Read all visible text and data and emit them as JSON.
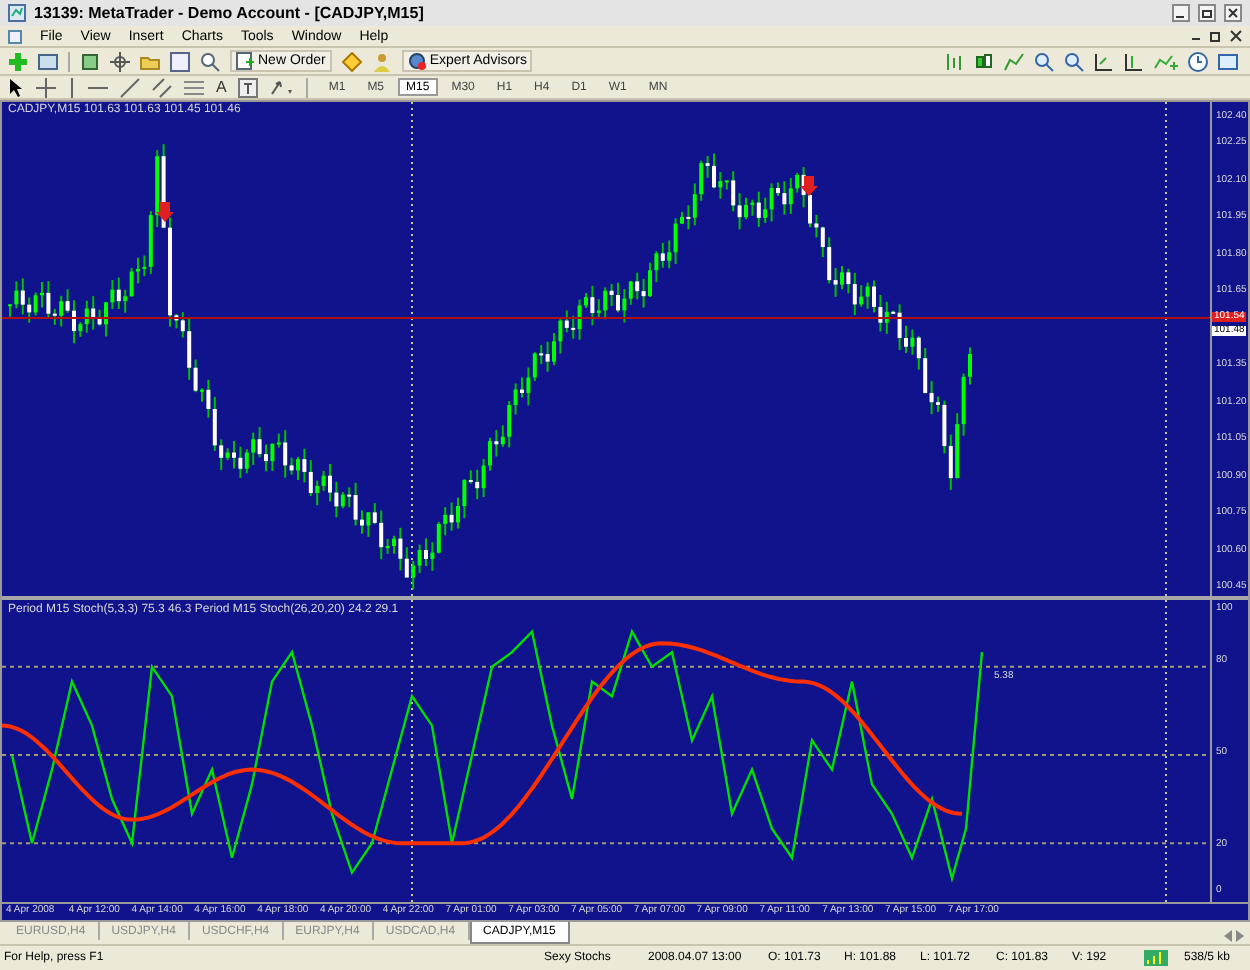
{
  "window": {
    "title": "13139: MetaTrader - Demo Account - [CADJPY,M15]"
  },
  "menu": [
    "File",
    "View",
    "Insert",
    "Charts",
    "Tools",
    "Window",
    "Help"
  ],
  "toolbar": {
    "buttons": [
      "New Order",
      "Expert Advisors"
    ]
  },
  "drawing_tools": {
    "text_tool": "A"
  },
  "timeframes": [
    {
      "label": "M1",
      "selected": false
    },
    {
      "label": "M5",
      "selected": false
    },
    {
      "label": "M15",
      "selected": true
    },
    {
      "label": "M30",
      "selected": false
    },
    {
      "label": "H1",
      "selected": false
    },
    {
      "label": "H4",
      "selected": false
    },
    {
      "label": "D1",
      "selected": false
    },
    {
      "label": "W1",
      "selected": false
    },
    {
      "label": "MN",
      "selected": false
    }
  ],
  "chart": {
    "header": "CADJPY,M15  101.63 101.63 101.45 101.46",
    "price_axis": [
      "102.40",
      "102.25",
      "102.10",
      "101.95",
      "101.80",
      "101.65",
      "101.35",
      "101.20",
      "101.05",
      "100.90",
      "100.75",
      "100.60",
      "100.45"
    ],
    "bid_label": "101.54",
    "ask_label": "101.48"
  },
  "indicator": {
    "header": "Period M15 Stoch(5,3,3) 75.3 46.3  Period M15 Stoch(26,20,20) 24.2 29.1",
    "value_label": "5.38",
    "axis": [
      "100",
      "80",
      "50",
      "20",
      "0"
    ]
  },
  "time_axis": [
    "4 Apr 2008",
    "4 Apr 12:00",
    "4 Apr 14:00",
    "4 Apr 16:00",
    "4 Apr 18:00",
    "4 Apr 20:00",
    "4 Apr 22:00",
    "7 Apr 01:00",
    "7 Apr 03:00",
    "7 Apr 05:00",
    "7 Apr 07:00",
    "7 Apr 09:00",
    "7 Apr 11:00",
    "7 Apr 13:00",
    "7 Apr 15:00",
    "7 Apr 17:00"
  ],
  "tabs": [
    {
      "label": "EURUSD,H4",
      "selected": false
    },
    {
      "label": "USDJPY,H4",
      "selected": false
    },
    {
      "label": "USDCHF,H4",
      "selected": false
    },
    {
      "label": "EURJPY,H4",
      "selected": false
    },
    {
      "label": "USDCAD,H4",
      "selected": false
    },
    {
      "label": "CADJPY,M15",
      "selected": true
    }
  ],
  "status_bar": {
    "help": "For Help, press F1",
    "profile": "Sexy Stochs",
    "time": "2008.04.07 13:00",
    "open": "O: 101.73",
    "high": "H: 101.88",
    "low": "L: 101.72",
    "close": "C: 101.83",
    "volume": "V: 192",
    "traffic": "538/5 kb"
  }
}
